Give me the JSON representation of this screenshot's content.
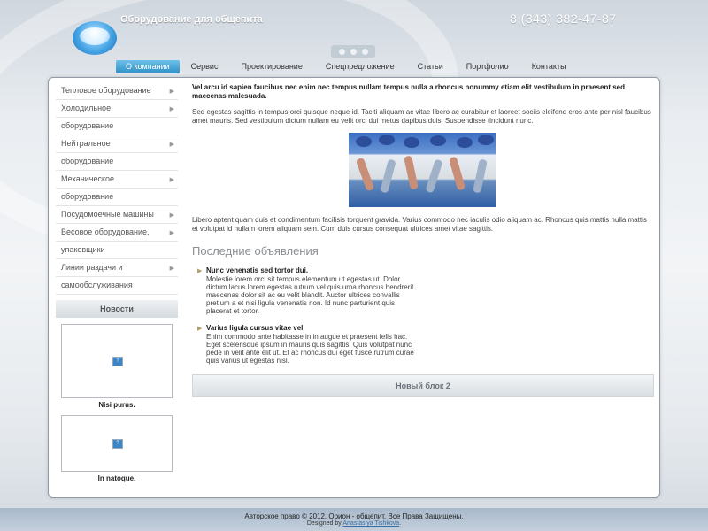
{
  "header": {
    "site_title": "Оборудование для общепита",
    "phone": "8 (343) 382-47-87"
  },
  "nav": {
    "items": [
      {
        "label": "О компании"
      },
      {
        "label": "Сервис"
      },
      {
        "label": "Проектирование"
      },
      {
        "label": "Спецпредложение"
      },
      {
        "label": "Статьи"
      },
      {
        "label": "Портфолио"
      },
      {
        "label": "Контакты"
      }
    ],
    "active_index": 0
  },
  "sidebar": {
    "menu": [
      {
        "label": "Тепловое оборудование",
        "arrow": "▶"
      },
      {
        "label": "Холодильное",
        "arrow": "▶"
      },
      {
        "label": "оборудование",
        "arrow": ""
      },
      {
        "label": "Нейтральное",
        "arrow": "▶"
      },
      {
        "label": "оборудование",
        "arrow": ""
      },
      {
        "label": "Механическое",
        "arrow": "▶"
      },
      {
        "label": "оборудование",
        "arrow": ""
      },
      {
        "label": "Посудомоечные машины",
        "arrow": "▶"
      },
      {
        "label": "Весовое оборудование,",
        "arrow": "▶"
      },
      {
        "label": "упаковщики",
        "arrow": ""
      },
      {
        "label": "Линии раздачи и",
        "arrow": "▶"
      },
      {
        "label": "самообслуживания",
        "arrow": ""
      }
    ],
    "news_title": "Новости",
    "news": [
      {
        "caption": "Nisi purus."
      },
      {
        "caption": "In natoque."
      }
    ]
  },
  "content": {
    "lead": "Vel arcu id sapien faucibus nec enim nec tempus nullam tempus nulla a rhoncus nonummy etiam elit vestibulum in praesent sed maecenas malesuada.",
    "para1": "Sed egestas sagittis in tempus orci quisque neque id. Taciti aliquam ac vitae libero ac curabitur et laoreet sociis eleifend eros ante per nisl faucibus amet mauris. Sed vestibulum dictum nullam eu velit orci dui metus dapibus duis. Suspendisse tincidunt nunc.",
    "para2": "Libero aptent quam duis et condimentum facilisis torquent gravida. Varius commodo nec iaculis odio aliquam ac. Rhoncus quis mattis nulla mattis et volutpat id nullam lorem aliquam sem. Cum duis cursus consequat ultrices amet vitae sagittis.",
    "announcements_title": "Последние объявления",
    "announcements": [
      {
        "title": "Nunc venenatis sed tortor dui.",
        "text": "Molestie lorem orci sit tempus elementum ut egestas ut. Dolor dictum lacus lorem egestas rutrum vel quis urna rhoncus hendrerit maecenas dolor sit ac eu velit blandit. Auctor ultrices convallis pretium a et nisi ligula venenatis non. Id nunc parturient quis placerat et tortor."
      },
      {
        "title": "Varius ligula cursus vitae vel.",
        "text": "Enim commodo ante habitasse in in augue et praesent felis hac. Eget scelerisque ipsum in mauris quis sagittis. Quis volutpat nunc pede in velit ante elit ut. Et ac rhoncus dui eget fusce rutrum curae quis varius ut egestas nisl."
      }
    ],
    "block2_title": "Новый блок 2"
  },
  "footer": {
    "copyright": "Авторское право © 2012, Орион - общепит. Все Права Защищены.",
    "designed_prefix": "Designed by",
    "designer": "Anastasiya Tishkova",
    "designed_suffix": "."
  },
  "colors": {
    "accent": "#2f8fc6",
    "bullet": "#b2a06a"
  }
}
